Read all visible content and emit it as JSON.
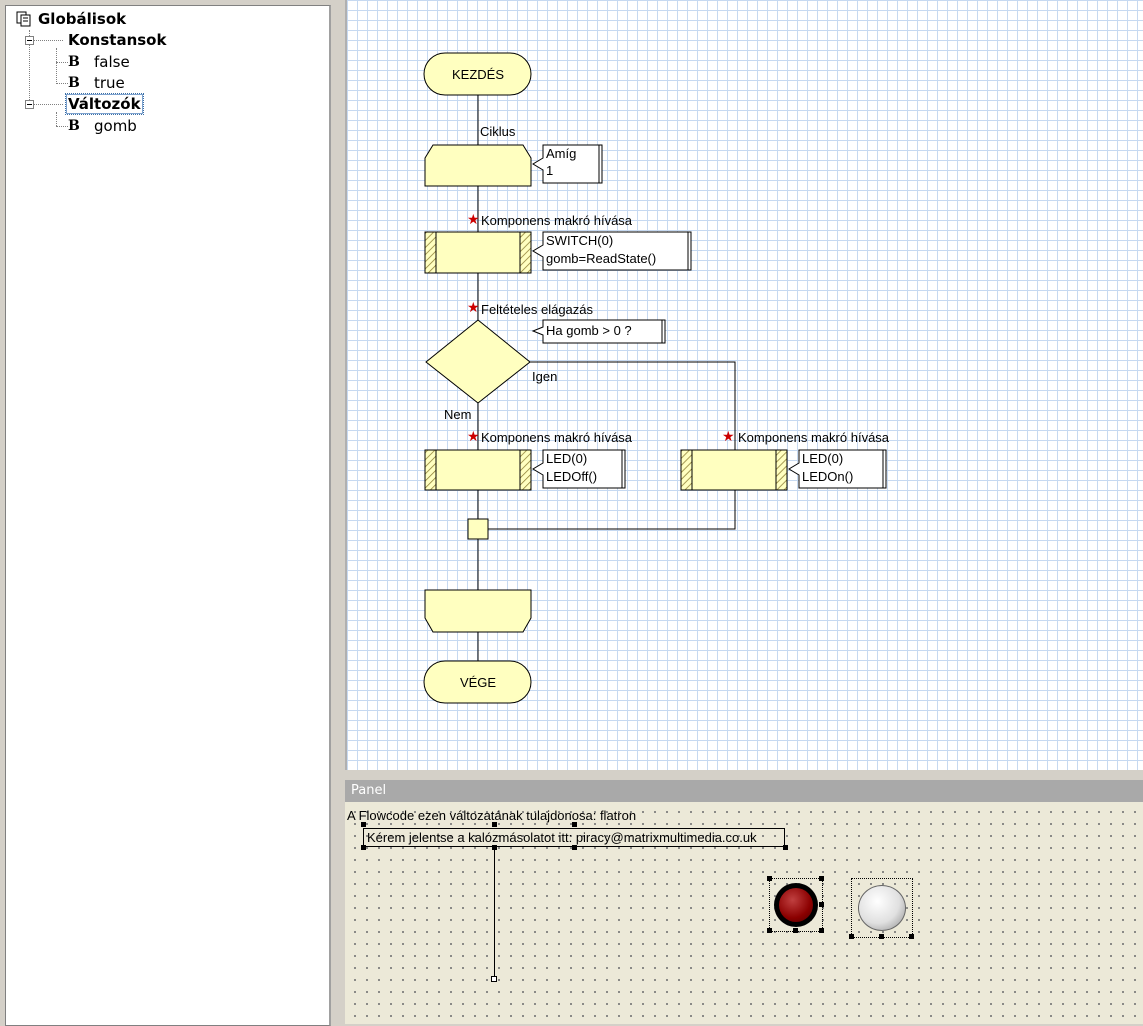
{
  "tree": {
    "root": "Globálisok",
    "constants_group": "Konstansok",
    "constants": [
      "false",
      "true"
    ],
    "variables_group": "Változók",
    "variables": [
      "gomb"
    ]
  },
  "flowchart": {
    "start": "KEZDÉS",
    "end": "VÉGE",
    "loop_label": "Ciklus",
    "loop_comment": [
      "Amíg",
      "1"
    ],
    "macro1_label": "Komponens makró hívása",
    "macro1_comment": [
      "SWITCH(0)",
      "gomb=ReadState()"
    ],
    "decision_label": "Feltételes elágazás",
    "decision_comment": "Ha gomb > 0 ?",
    "yes_label": "Igen",
    "no_label": "Nem",
    "macro2_label": "Komponens makró hívása",
    "macro2_comment": [
      "LED(0)",
      "LEDOff()"
    ],
    "macro3_label": "Komponens makró hívása",
    "macro3_comment": [
      "LED(0)",
      "LEDOn()"
    ]
  },
  "panel": {
    "title": "Panel",
    "owner_text": "A Flowcode ezen változatának tulajdonosa: flatron",
    "piracy_text": "Kérem jelentse a kalózmásolatot itt: piracy@matrixmultimedia.co.uk",
    "led_color": "#8b0000",
    "button_color": "#e8e8e8"
  }
}
